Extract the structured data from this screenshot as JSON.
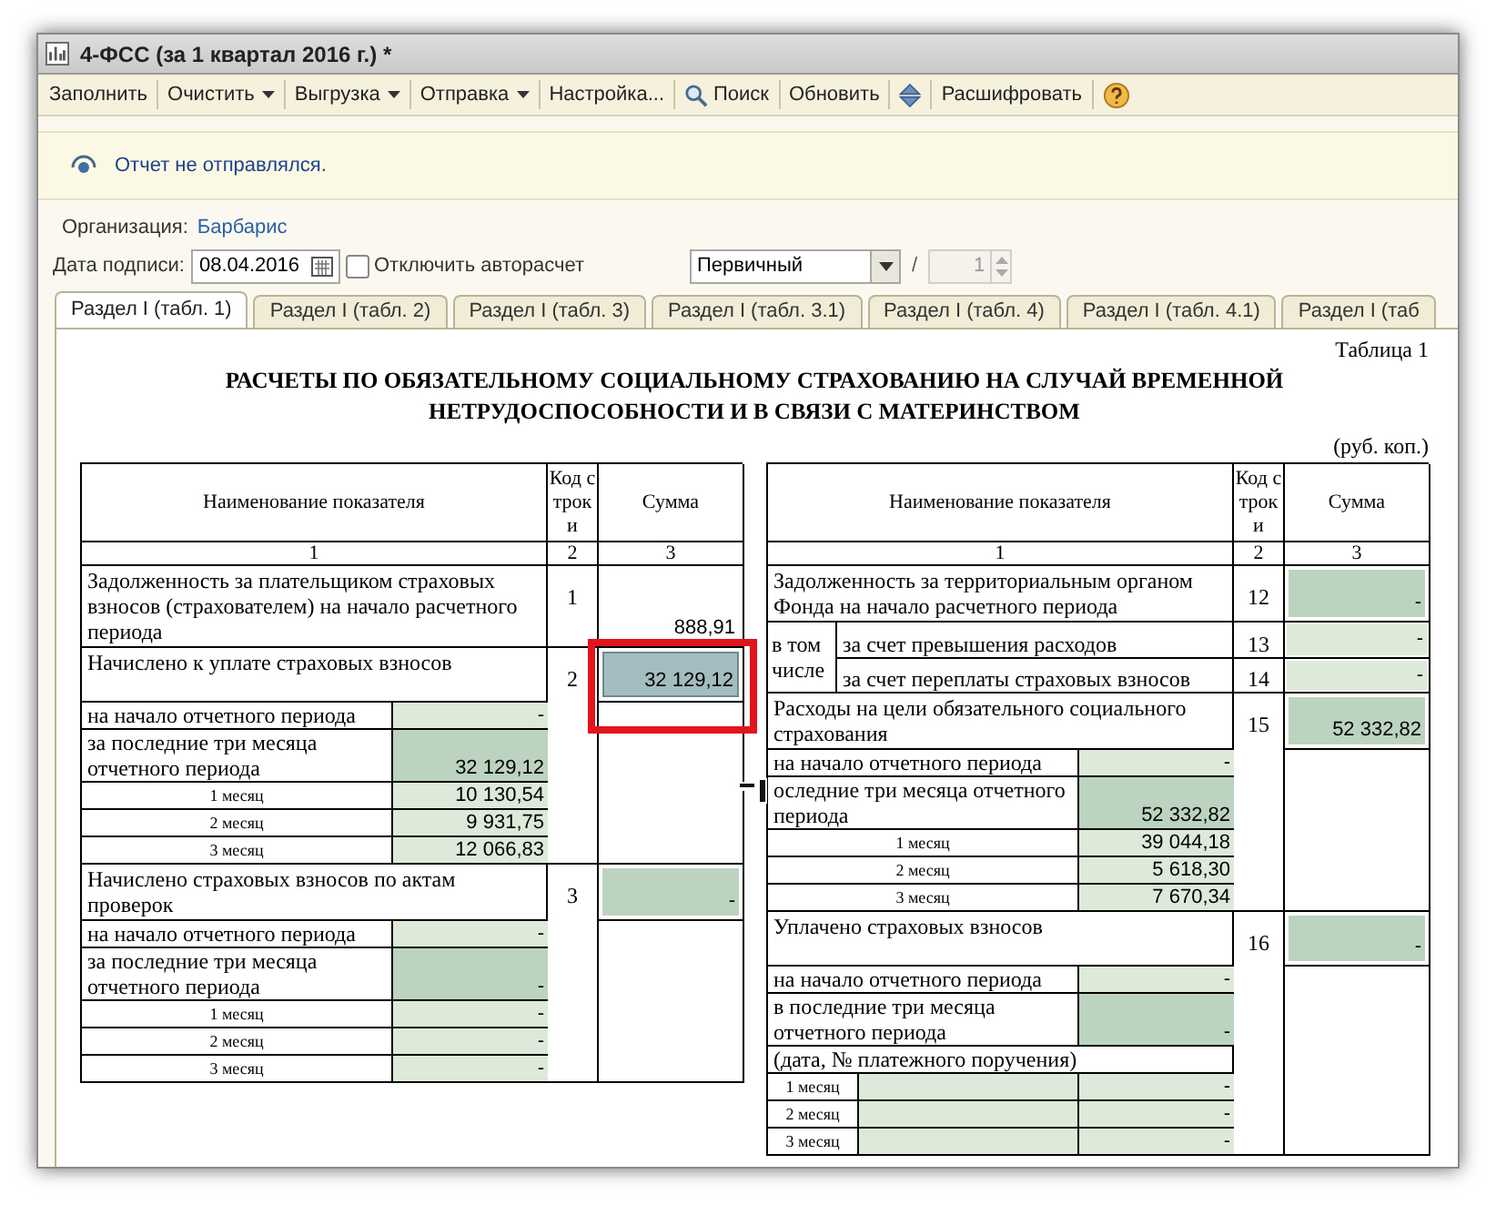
{
  "window": {
    "title": "4-ФСС (за 1 квартал 2016 г.) *"
  },
  "toolbar": [
    {
      "kind": "button",
      "label": "Заполнить"
    },
    {
      "kind": "menu",
      "label": "Очистить"
    },
    {
      "kind": "menu",
      "label": "Выгрузка"
    },
    {
      "kind": "menu",
      "label": "Отправка"
    },
    {
      "kind": "button",
      "label": "Настройка..."
    },
    {
      "kind": "search",
      "label": "Поиск"
    },
    {
      "kind": "button",
      "label": "Обновить"
    },
    {
      "kind": "arrows"
    },
    {
      "kind": "button",
      "label": "Расшифровать"
    },
    {
      "kind": "help"
    }
  ],
  "notice": "Отчет не отправлялся.",
  "organization": {
    "label": "Организация:",
    "value": "Барбарис"
  },
  "signature_date": {
    "label": "Дата подписи:",
    "value": "08.04.2016"
  },
  "disable_autocalc": {
    "label": "Отключить авторасчет",
    "checked": false
  },
  "report_type": {
    "value": "Первичный"
  },
  "separator": "/",
  "correction_number": {
    "value": "1",
    "disabled": true
  },
  "tabs": [
    {
      "label": "Раздел I (табл. 1)",
      "selected": true
    },
    {
      "label": "Раздел I (табл. 2)",
      "selected": false
    },
    {
      "label": "Раздел I (табл. 3)",
      "selected": false
    },
    {
      "label": "Раздел I (табл. 3.1)",
      "selected": false
    },
    {
      "label": "Раздел I (табл. 4)",
      "selected": false
    },
    {
      "label": "Раздел I (табл. 4.1)",
      "selected": false
    },
    {
      "label": "Раздел I (таб",
      "selected": false
    }
  ],
  "sheet": {
    "table_label": "Таблица 1",
    "title": "РАСЧЕТЫ ПО ОБЯЗАТЕЛЬНОМУ СОЦИАЛЬНОМУ СТРАХОВАНИЮ НА СЛУЧАЙ ВРЕМЕННОЙ НЕТРУДОСПОСОБНОСТИ И В СВЯЗИ С МАТЕРИНСТВОМ",
    "units": "(руб. коп.)",
    "tables": [
      {
        "columns": [
          "Наименование показателя",
          "Код строки",
          "Сумма"
        ],
        "column_numbers": [
          "1",
          "2",
          "3"
        ],
        "groups": [
          {
            "kind": "group",
            "label": "Задолженность за плательщиком страховых взносов (страхователем) на начало расчетного периода",
            "code": "1",
            "sum": {
              "value": "888,91",
              "selected": false
            }
          },
          {
            "kind": "group",
            "label": "Начислено к уплате страховых взносов",
            "code": "2",
            "sum": {
              "value": "32 129,12",
              "selected": true
            },
            "rows": [
              {
                "kind": "sub",
                "label": "на начало отчетного периода",
                "value": "-",
                "color": "#dde9d9"
              },
              {
                "kind": "sub",
                "label": "за последние три месяца отчетного периода",
                "value": "32 129,12",
                "color": "#bcd4bf"
              },
              {
                "kind": "month",
                "label": "1 месяц",
                "value": "10 130,54",
                "color": "#dde9d9"
              },
              {
                "kind": "month",
                "label": "2 месяц",
                "value": "9 931,75",
                "color": "#dde9d9"
              },
              {
                "kind": "month",
                "label": "3 месяц",
                "value": "12 066,83",
                "color": "#dde9d9"
              }
            ]
          },
          {
            "kind": "group",
            "label": "Начислено страховых взносов по актам проверок",
            "code": "3",
            "sum": {
              "value": "-",
              "color": "#bcd4bf",
              "selected": false
            },
            "rows": [
              {
                "kind": "sub",
                "label": "на начало отчетного периода",
                "value": "-",
                "color": "#dde9d9"
              },
              {
                "kind": "sub",
                "label": "за последние три месяца отчетного периода",
                "value": "-",
                "color": "#bcd4bf"
              },
              {
                "kind": "month",
                "label": "1 месяц",
                "value": "-",
                "color": "#dde9d9"
              },
              {
                "kind": "month",
                "label": "2 месяц",
                "value": "-",
                "color": "#dde9d9"
              },
              {
                "kind": "month",
                "label": "3 месяц",
                "value": "-",
                "color": "#dde9d9"
              }
            ]
          }
        ]
      },
      {
        "columns": [
          "Наименование показателя",
          "Код строки",
          "Сумма"
        ],
        "column_numbers": [
          "1",
          "2",
          "3"
        ],
        "groups": [
          {
            "kind": "group",
            "label": "Задолженность за территориальным органом Фонда на  начало расчетного периода",
            "code": "12",
            "sum": {
              "value": "-",
              "color": "#bcd4bf",
              "selected": false
            }
          },
          {
            "kind": "breakdown",
            "label": "в том числе",
            "items": [
              {
                "label": "за счет превышения расходов",
                "code": "13",
                "sum": {
                  "value": "-",
                  "color": "#dde9d9",
                  "selected": false
                }
              },
              {
                "label": "за счет переплаты страховых взносов",
                "code": "14",
                "sum": {
                  "value": "-",
                  "color": "#dde9d9",
                  "selected": false
                }
              }
            ]
          },
          {
            "kind": "group",
            "label": "Расходы на цели обязательного социального страхования",
            "code": "15",
            "sum": {
              "value": "52 332,82",
              "color": "#bcd4bf",
              "selected": false
            },
            "rows": [
              {
                "kind": "sub",
                "label": "на начало отчетного периода",
                "value": "-",
                "color": "#dde9d9"
              },
              {
                "kind": "sub",
                "label": "оследние три месяца отчетного периода",
                "value": "52 332,82",
                "color": "#bcd4bf",
                "cursor": true
              },
              {
                "kind": "month",
                "label": "1 месяц",
                "value": "39 044,18",
                "color": "#dde9d9"
              },
              {
                "kind": "month",
                "label": "2 месяц",
                "value": "5 618,30",
                "color": "#dde9d9"
              },
              {
                "kind": "month",
                "label": "3 месяц",
                "value": "7 670,34",
                "color": "#dde9d9"
              }
            ]
          },
          {
            "kind": "group",
            "label": "Уплачено страховых взносов",
            "code": "16",
            "sum": {
              "value": "-",
              "color": "#bcd4bf",
              "selected": false
            },
            "rows": [
              {
                "kind": "sub",
                "label": "на начало отчетного периода",
                "value": "-",
                "color": "#dde9d9"
              },
              {
                "kind": "sub",
                "label": "в последние три месяца отчетного периода",
                "value": "-",
                "color": "#bcd4bf"
              },
              {
                "kind": "note",
                "label": "(дата, № платежного поручения)"
              },
              {
                "kind": "payment_month",
                "label": "1 месяц",
                "value": "-",
                "color": "#dde9d9"
              },
              {
                "kind": "payment_month",
                "label": "2 месяц",
                "value": "-",
                "color": "#dde9d9"
              },
              {
                "kind": "payment_month",
                "label": "3 месяц",
                "value": "-",
                "color": "#dde9d9"
              }
            ]
          }
        ]
      }
    ]
  }
}
